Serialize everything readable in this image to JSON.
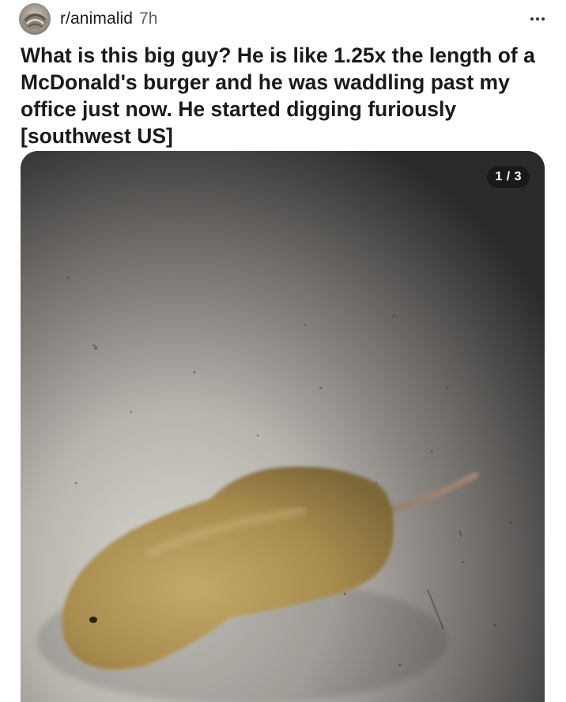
{
  "post": {
    "subreddit": "r/animalid",
    "age": "7h",
    "title": "What is this big guy? He is like 1.25x the length of a McDonald's burger and he was waddling past my office just now. He started digging furiously [southwest US]",
    "media": {
      "counter": "1 / 3"
    }
  },
  "icons": {
    "avatar": "subreddit-avatar-icon",
    "more": "more-options-icon"
  },
  "colors": {
    "background": "#ffffff",
    "title": "#1a1a1b",
    "meta": "#5c6063",
    "counter_bg": "#141414"
  }
}
